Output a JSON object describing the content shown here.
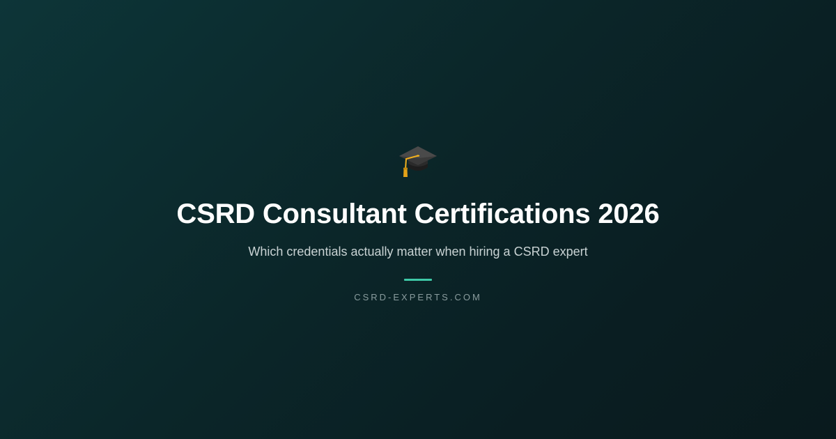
{
  "hero": {
    "icon": "graduation-cap-icon",
    "title": "CSRD Consultant Certifications 2026",
    "subtitle": "Which credentials actually matter when hiring a CSRD expert",
    "site": "CSRD-EXPERTS.COM"
  },
  "colors": {
    "background_start": "#0d3538",
    "background_end": "#091a1d",
    "accent": "#3ec9a7",
    "title": "#ffffff",
    "subtitle": "#c9d3d4",
    "site": "#8a9c9e"
  }
}
